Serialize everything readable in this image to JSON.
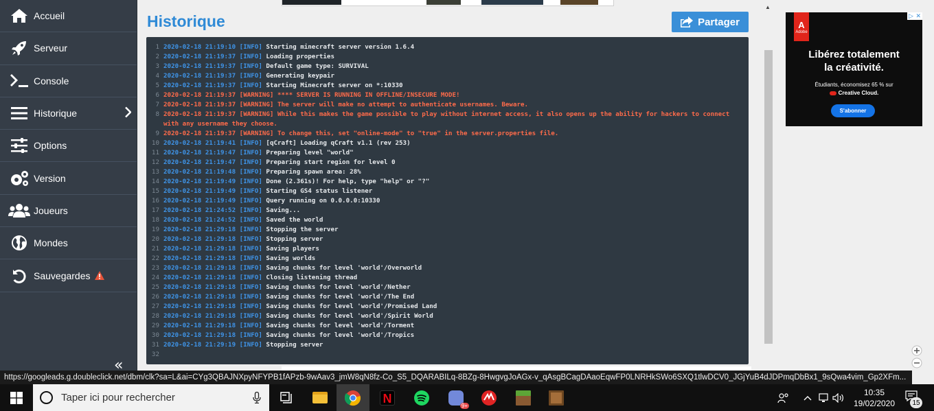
{
  "sidebar": {
    "items": [
      {
        "label": "Accueil",
        "icon": "home-icon"
      },
      {
        "label": "Serveur",
        "icon": "rocket-icon"
      },
      {
        "label": "Console",
        "icon": "terminal-icon"
      },
      {
        "label": "Historique",
        "icon": "list-icon"
      },
      {
        "label": "Options",
        "icon": "sliders-icon"
      },
      {
        "label": "Version",
        "icon": "gears-icon"
      },
      {
        "label": "Joueurs",
        "icon": "users-icon"
      },
      {
        "label": "Mondes",
        "icon": "globe-icon"
      },
      {
        "label": "Sauvegardes",
        "icon": "undo-icon"
      }
    ],
    "collapse_glyph": "«"
  },
  "header": {
    "title": "Historique",
    "share_label": "Partager"
  },
  "console": {
    "lines": [
      {
        "n": "1",
        "ts": "2020-02-18 21:19:10",
        "lvl": "[INFO]",
        "msg": "Starting minecraft server version 1.6.4"
      },
      {
        "n": "2",
        "ts": "2020-02-18 21:19:37",
        "lvl": "[INFO]",
        "msg": "Loading properties"
      },
      {
        "n": "3",
        "ts": "2020-02-18 21:19:37",
        "lvl": "[INFO]",
        "msg": "Default game type: SURVIVAL"
      },
      {
        "n": "4",
        "ts": "2020-02-18 21:19:37",
        "lvl": "[INFO]",
        "msg": "Generating keypair"
      },
      {
        "n": "5",
        "ts": "2020-02-18 21:19:37",
        "lvl": "[INFO]",
        "msg": "Starting Minecraft server on *:10330"
      },
      {
        "n": "6",
        "ts": "2020-02-18 21:19:37",
        "lvl": "[WARNING]",
        "msg": "**** SERVER IS RUNNING IN OFFLINE/INSECURE MODE!"
      },
      {
        "n": "7",
        "ts": "2020-02-18 21:19:37",
        "lvl": "[WARNING]",
        "msg": "The server will make no attempt to authenticate usernames. Beware."
      },
      {
        "n": "8",
        "ts": "2020-02-18 21:19:37",
        "lvl": "[WARNING]",
        "msg": "While this makes the game possible to play without internet access, it also opens up the ability for hackers to connect with any username they choose."
      },
      {
        "n": "9",
        "ts": "2020-02-18 21:19:37",
        "lvl": "[WARNING]",
        "msg": "To change this, set \"online-mode\" to \"true\" in the server.properties file."
      },
      {
        "n": "10",
        "ts": "2020-02-18 21:19:41",
        "lvl": "[INFO]",
        "msg": "[qCraft] Loading qCraft v1.1 (rev 253)"
      },
      {
        "n": "11",
        "ts": "2020-02-18 21:19:47",
        "lvl": "[INFO]",
        "msg": "Preparing level \"world\""
      },
      {
        "n": "12",
        "ts": "2020-02-18 21:19:47",
        "lvl": "[INFO]",
        "msg": "Preparing start region for level 0"
      },
      {
        "n": "13",
        "ts": "2020-02-18 21:19:48",
        "lvl": "[INFO]",
        "msg": "Preparing spawn area: 28%"
      },
      {
        "n": "14",
        "ts": "2020-02-18 21:19:49",
        "lvl": "[INFO]",
        "msg": "Done (2.361s)! For help, type \"help\" or \"?\""
      },
      {
        "n": "15",
        "ts": "2020-02-18 21:19:49",
        "lvl": "[INFO]",
        "msg": "Starting GS4 status listener"
      },
      {
        "n": "16",
        "ts": "2020-02-18 21:19:49",
        "lvl": "[INFO]",
        "msg": "Query running on 0.0.0.0:10330"
      },
      {
        "n": "17",
        "ts": "2020-02-18 21:24:52",
        "lvl": "[INFO]",
        "msg": "Saving..."
      },
      {
        "n": "18",
        "ts": "2020-02-18 21:24:52",
        "lvl": "[INFO]",
        "msg": "Saved the world"
      },
      {
        "n": "19",
        "ts": "2020-02-18 21:29:18",
        "lvl": "[INFO]",
        "msg": "Stopping the server"
      },
      {
        "n": "20",
        "ts": "2020-02-18 21:29:18",
        "lvl": "[INFO]",
        "msg": "Stopping server"
      },
      {
        "n": "21",
        "ts": "2020-02-18 21:29:18",
        "lvl": "[INFO]",
        "msg": "Saving players"
      },
      {
        "n": "22",
        "ts": "2020-02-18 21:29:18",
        "lvl": "[INFO]",
        "msg": "Saving worlds"
      },
      {
        "n": "23",
        "ts": "2020-02-18 21:29:18",
        "lvl": "[INFO]",
        "msg": "Saving chunks for level 'world'/Overworld"
      },
      {
        "n": "24",
        "ts": "2020-02-18 21:29:18",
        "lvl": "[INFO]",
        "msg": "Closing listening thread"
      },
      {
        "n": "25",
        "ts": "2020-02-18 21:29:18",
        "lvl": "[INFO]",
        "msg": "Saving chunks for level 'world'/Nether"
      },
      {
        "n": "26",
        "ts": "2020-02-18 21:29:18",
        "lvl": "[INFO]",
        "msg": "Saving chunks for level 'world'/The End"
      },
      {
        "n": "27",
        "ts": "2020-02-18 21:29:18",
        "lvl": "[INFO]",
        "msg": "Saving chunks for level 'world'/Promised Land"
      },
      {
        "n": "28",
        "ts": "2020-02-18 21:29:18",
        "lvl": "[INFO]",
        "msg": "Saving chunks for level 'world'/Spirit World"
      },
      {
        "n": "29",
        "ts": "2020-02-18 21:29:18",
        "lvl": "[INFO]",
        "msg": "Saving chunks for level 'world'/Torment"
      },
      {
        "n": "30",
        "ts": "2020-02-18 21:29:18",
        "lvl": "[INFO]",
        "msg": "Saving chunks for level 'world'/Tropics"
      },
      {
        "n": "31",
        "ts": "2020-02-18 21:29:19",
        "lvl": "[INFO]",
        "msg": "Stopping server"
      },
      {
        "n": "32",
        "ts": "",
        "lvl": "",
        "msg": ""
      }
    ]
  },
  "ad": {
    "brand": "Adobe",
    "headline_1": "Libérez totalement",
    "headline_2": "la créativité.",
    "sub_1": "Étudiants, économisez 65 % sur",
    "sub_2": "Creative Cloud.",
    "cta": "S'abonner"
  },
  "statusbar": {
    "url": "https://googleads.g.doubleclick.net/dbm/clk?sa=L&ai=CYg3QBAJNXpyNFYPB1fAPzb-9wAav3_jmW8qN8fz-Co_S5_DQARABILq-8BZg-8HwgvgJoAGx-v_qAsgBCagDAaoEqwFP0LNRHkSWo6SXQ1tlwDCV0_JGjYuB4dJDPmqDbBx1_9sQwa4vim_Gp2XFm..."
  },
  "taskbar": {
    "search_placeholder": "Taper ici pour rechercher",
    "time": "10:35",
    "date": "19/02/2020",
    "notification_count": "15",
    "discord_badge": "9+"
  },
  "colors": {
    "accent": "#2f8ad6",
    "sidebar_bg": "#353d47",
    "console_bg": "#2f3942",
    "info": "#3f94e8",
    "warning": "#ff6b4a"
  }
}
